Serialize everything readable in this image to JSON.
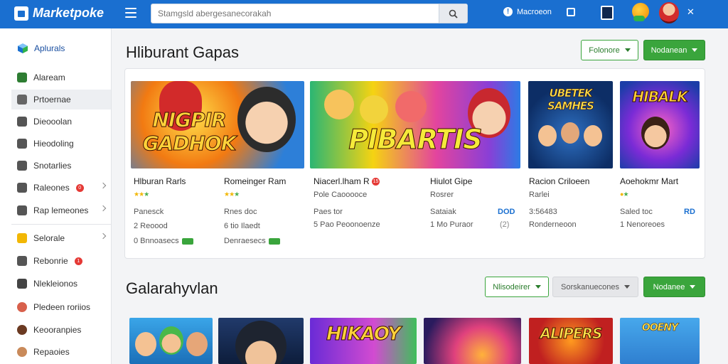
{
  "header": {
    "brand": "Marketpoke",
    "search_placeholder": "Stamgsld abergesanecorakah",
    "help_label": "Macroeon"
  },
  "sidebar": {
    "head": "Aplurals",
    "items": [
      {
        "label": "Alaream"
      },
      {
        "label": "Prtoernae"
      },
      {
        "label": "Dieooolan"
      },
      {
        "label": "Hieodoling"
      },
      {
        "label": "Snotarlies"
      },
      {
        "label": "Raleones",
        "badge": "0"
      },
      {
        "label": "Rap lemeones"
      },
      {
        "label": "Selorale"
      },
      {
        "label": "Rebonrie",
        "badge": "1"
      },
      {
        "label": "Nlekleionos"
      },
      {
        "label": "Pledeen roriios"
      },
      {
        "label": "Keooranpies"
      },
      {
        "label": "Repaoies"
      }
    ]
  },
  "section1": {
    "title": "Hliburant Gapas",
    "filter_label": "Folonore",
    "primary_label": "Nodanean"
  },
  "section2": {
    "title": "Galarahyvlan",
    "filter_label": "Nlisodeirer",
    "secondary_label": "Sorskanuecones",
    "primary_label": "Nodanee"
  },
  "thumbs": [
    {
      "title": "NIGPIR GADHOK"
    },
    {
      "title": "PIBARTIS"
    },
    {
      "title": "UBETEK SAMHES"
    },
    {
      "title": "HIBALK"
    }
  ],
  "cards": [
    {
      "name": "Hlburan Rarls",
      "sub1": "Panesck",
      "sub2": "2 Reoood",
      "sub3": "0 Bnnoasecs"
    },
    {
      "name": "Romeinger Ram",
      "sub1": "Rnes doc",
      "sub2": "6 tio Ilaedt",
      "sub3": "Denraesecs"
    },
    {
      "name": "Niacerl.lham R",
      "badge": "15",
      "meta": "Pole Caooooce",
      "sub1": "Paes tor",
      "sub2": "5 Pao Peoonoenze"
    },
    {
      "name": "Hiulot Gipe",
      "meta": "Rosrer",
      "sub1": "Sataiak",
      "sub1_value": "DOD",
      "sub2": "1 Mo Puraor",
      "sub2_value": "(2)"
    },
    {
      "name": "Racion Criloeen",
      "meta": "Rarlei",
      "sub1": "3:56483",
      "sub2": "Ronderneoon"
    },
    {
      "name": "Aoehokmr Mart",
      "sub1": "Saled toc",
      "sub1_value": "RD",
      "sub2": "1 Nenoreoes"
    }
  ],
  "colors": {
    "topbar": "#1a6fd0",
    "accent_green": "#3aa53c",
    "badge_red": "#e53935"
  }
}
